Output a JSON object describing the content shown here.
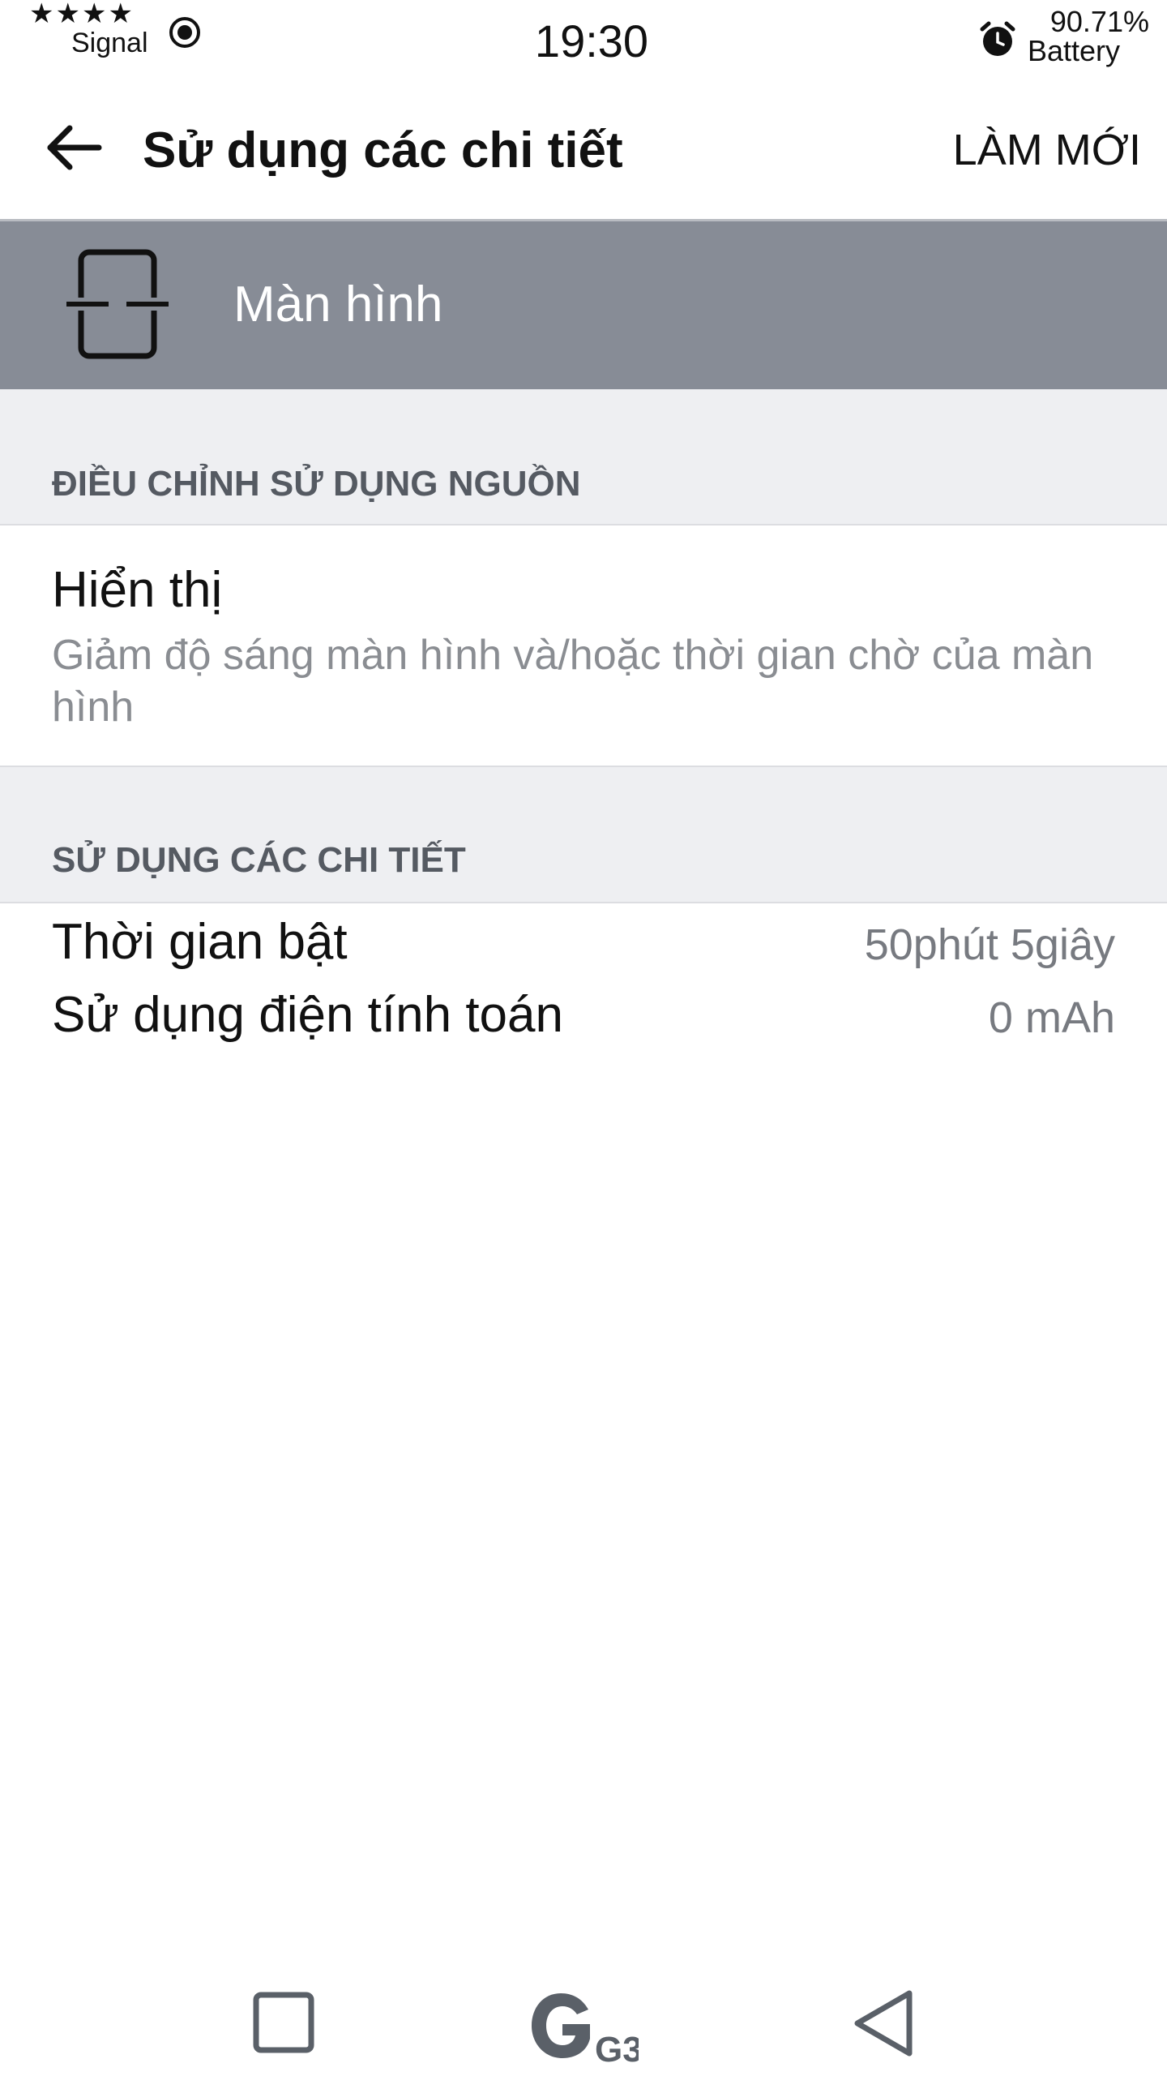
{
  "status_bar": {
    "stars": "★★★★",
    "signal_label": "Signal",
    "time": "19:30",
    "battery_percent": "90.71%",
    "battery_label": "Battery",
    "icons": [
      "signal-icon",
      "alarm-icon"
    ]
  },
  "app_bar": {
    "title": "Sử dụng các chi tiết",
    "refresh_label": "LÀM MỚI",
    "back_icon": "arrow-left-icon"
  },
  "header_band": {
    "label": "Màn hình",
    "icon": "screen-icon"
  },
  "sections": {
    "adjust_power": {
      "header": "ĐIỀU CHỈNH SỬ DỤNG NGUỒN",
      "item_title": "Hiển thị",
      "item_summary": "Giảm độ sáng màn hình và/hoặc thời gian chờ của màn hình"
    },
    "usage_details": {
      "header": "SỬ DỤNG CÁC CHI TIẾT",
      "rows": [
        {
          "label": "Thời gian bật",
          "value": "50phút 5giây"
        },
        {
          "label": "Sử dụng điện tính toán",
          "value": "0 mAh"
        }
      ]
    }
  },
  "nav_bar": {
    "home_logo": "G3",
    "icons": [
      "recents-icon",
      "home-g3-icon",
      "back-triangle-icon"
    ]
  },
  "colors": {
    "header_band": "#878c96",
    "section_background": "#eeeff2",
    "section_text": "#555a62",
    "secondary_text": "#8a8d92",
    "nav_icon": "#5a6068"
  }
}
